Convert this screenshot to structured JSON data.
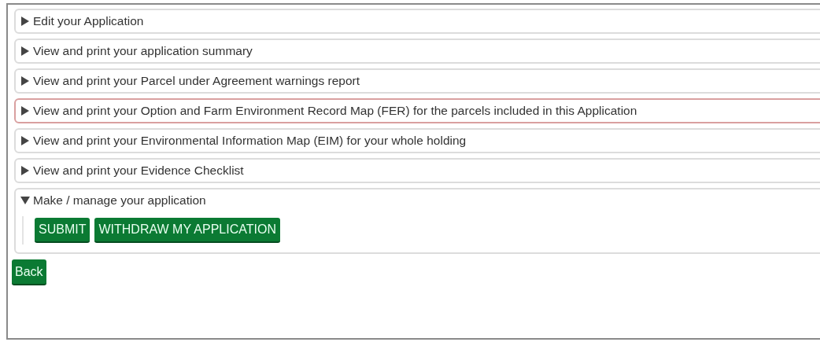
{
  "sections": [
    {
      "title": "Edit your Application",
      "expanded": false,
      "highlighted": false
    },
    {
      "title": "View and print your application summary",
      "expanded": false,
      "highlighted": false
    },
    {
      "title": "View and print your Parcel under Agreement warnings report",
      "expanded": false,
      "highlighted": false
    },
    {
      "title": "View and print your Option and Farm Environment Record Map (FER) for the parcels included in this Application",
      "expanded": false,
      "highlighted": true
    },
    {
      "title": "View and print your Environmental Information Map (EIM) for your whole holding",
      "expanded": false,
      "highlighted": false
    },
    {
      "title": "View and print your Evidence Checklist",
      "expanded": false,
      "highlighted": false
    },
    {
      "title": "Make / manage your application",
      "expanded": true,
      "highlighted": false,
      "buttons": [
        "SUBMIT",
        "WITHDRAW MY APPLICATION"
      ]
    }
  ],
  "back_button": "Back"
}
